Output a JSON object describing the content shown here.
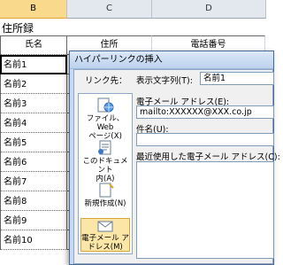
{
  "columns": [
    "B",
    "C",
    "D"
  ],
  "sheet_title": "住所録",
  "headers": {
    "name": "氏名",
    "address": "住所",
    "phone": "電話番号"
  },
  "rows": [
    {
      "name": "名前1",
      "c": "X"
    },
    {
      "name": "名前2",
      "c": "X"
    },
    {
      "name": "名前3",
      "c": "X"
    },
    {
      "name": "名前4",
      "c": "X"
    },
    {
      "name": "名前5",
      "c": "X"
    },
    {
      "name": "名前6",
      "c": "X"
    },
    {
      "name": "名前7",
      "c": "X"
    },
    {
      "name": "名前8",
      "c": "X"
    },
    {
      "name": "名前9",
      "c": "X"
    },
    {
      "name": "名前10",
      "c": "X"
    }
  ],
  "dialog": {
    "title": "ハイパーリンクの挿入",
    "link_to_label": "リンク先：",
    "nav": [
      {
        "label1": "ファイル、Web",
        "label2": "ページ(X)",
        "icon": "file-web-icon"
      },
      {
        "label1": "このドキュメント",
        "label2": "内(A)",
        "icon": "document-icon"
      },
      {
        "label1": "新規作成(N)",
        "label2": "",
        "icon": "new-document-icon"
      },
      {
        "label1": "電子メール ア",
        "label2": "ドレス(M)",
        "icon": "email-icon"
      }
    ],
    "display_text_label": "表示文字列(T):",
    "display_text_value": "名前1",
    "email_label": "電子メール アドレス(E):",
    "email_value": "mailto:XXXXXX@XXX.co.jp",
    "subject_label": "件名(U):",
    "subject_value": "",
    "recent_label": "最近使用した電子メール アドレス(C):"
  },
  "colors": {
    "selected_column": "#f9d98b",
    "dialog_frame": "#c5d9f1",
    "selected_nav": "#fbe6a8"
  }
}
